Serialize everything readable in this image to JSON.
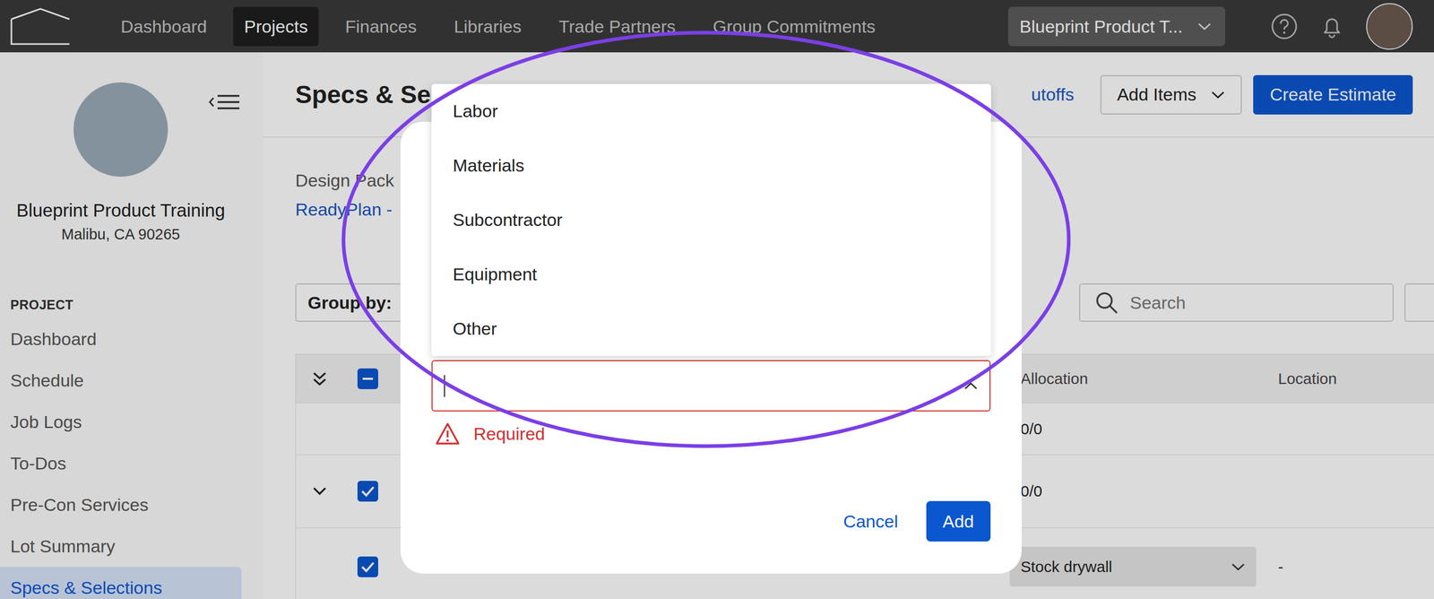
{
  "nav": {
    "items": [
      {
        "label": "Dashboard",
        "selected": false
      },
      {
        "label": "Projects",
        "selected": true
      },
      {
        "label": "Finances",
        "selected": false
      },
      {
        "label": "Libraries",
        "selected": false
      },
      {
        "label": "Trade Partners",
        "selected": false
      },
      {
        "label": "Group Commitments",
        "selected": false
      }
    ],
    "project_switcher": "Blueprint Product T..."
  },
  "sidebar": {
    "project_name": "Blueprint Product Training",
    "address": "Malibu, CA 90265",
    "section": "PROJECT",
    "items": [
      {
        "label": "Dashboard",
        "selected": false
      },
      {
        "label": "Schedule",
        "selected": false
      },
      {
        "label": "Job Logs",
        "selected": false
      },
      {
        "label": "To-Dos",
        "selected": false
      },
      {
        "label": "Pre-Con Services",
        "selected": false
      },
      {
        "label": "Lot Summary",
        "selected": false
      },
      {
        "label": "Specs & Selections",
        "selected": true
      }
    ]
  },
  "page": {
    "title": "Specs & Se",
    "cutoffs_link": "utoffs",
    "actions": [
      {
        "label": "Add Items",
        "kind": "menu"
      },
      {
        "label": "Create Estimate",
        "kind": "primary"
      }
    ],
    "design_package_label": "Design Pack",
    "design_package_value": "ReadyPlan -",
    "group_by_label": "Group by:",
    "search_placeholder": "Search"
  },
  "table": {
    "columns": [
      "Allocation",
      "Location"
    ],
    "all_checked": false,
    "some_checked": true,
    "rows": [
      {
        "kind": "summary",
        "allocation": "0/0"
      },
      {
        "kind": "group",
        "expanded": true,
        "checked": true,
        "allocation": "0/0"
      },
      {
        "kind": "item",
        "checked": true,
        "allocation": "Stock drywall",
        "location": "-"
      }
    ]
  },
  "dialog": {
    "input_value": "",
    "focused": true,
    "error": "Required",
    "menu_open": true,
    "options": [
      {
        "label": "Labor",
        "selected": false
      },
      {
        "label": "Materials",
        "selected": false
      },
      {
        "label": "Subcontractor",
        "selected": false
      },
      {
        "label": "Equipment",
        "selected": false
      },
      {
        "label": "Other",
        "selected": false
      }
    ],
    "buttons": [
      {
        "label": "Cancel",
        "kind": "text"
      },
      {
        "label": "Add",
        "kind": "primary"
      }
    ]
  }
}
